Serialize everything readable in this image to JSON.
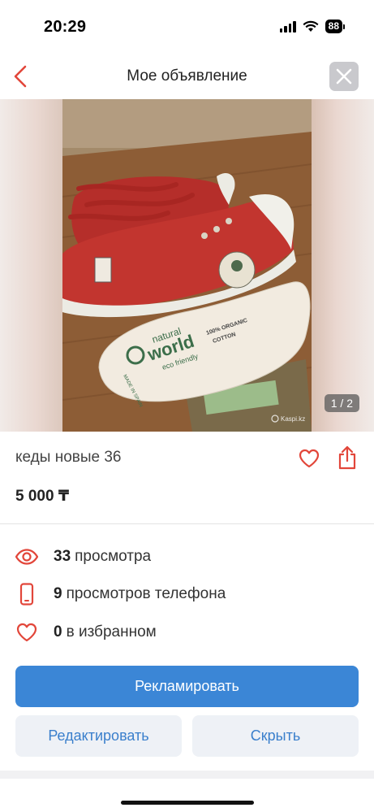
{
  "status_bar": {
    "time": "20:29",
    "battery": "88"
  },
  "header": {
    "title": "Мое объявление",
    "back_icon": "chevron-left-icon",
    "close_icon": "close-icon"
  },
  "gallery": {
    "page_indicator": "1 / 2",
    "watermark": "Kaspi.kz",
    "photo_text": {
      "brand_line1": "natural",
      "brand_line2": "world",
      "brand_line3": "eco friendly",
      "organic_line1": "100% ORGANIC",
      "organic_line2": "COTTON",
      "made_in": "MADE IN SPAIN"
    }
  },
  "listing": {
    "title": "кеды новые 36",
    "price": "5 000 ₸"
  },
  "stats": [
    {
      "icon": "eye-icon",
      "count": "33",
      "label": "просмотра"
    },
    {
      "icon": "phone-icon",
      "count": "9",
      "label": "просмотров телефона"
    },
    {
      "icon": "heart-icon",
      "count": "0",
      "label": "в избранном"
    }
  ],
  "actions": {
    "promote": "Рекламировать",
    "edit": "Редактировать",
    "hide": "Скрыть"
  },
  "colors": {
    "accent": "#e2463a",
    "primary": "#3b86d6",
    "secondary_bg": "#eef1f6",
    "secondary_text": "#3a7fcc"
  }
}
